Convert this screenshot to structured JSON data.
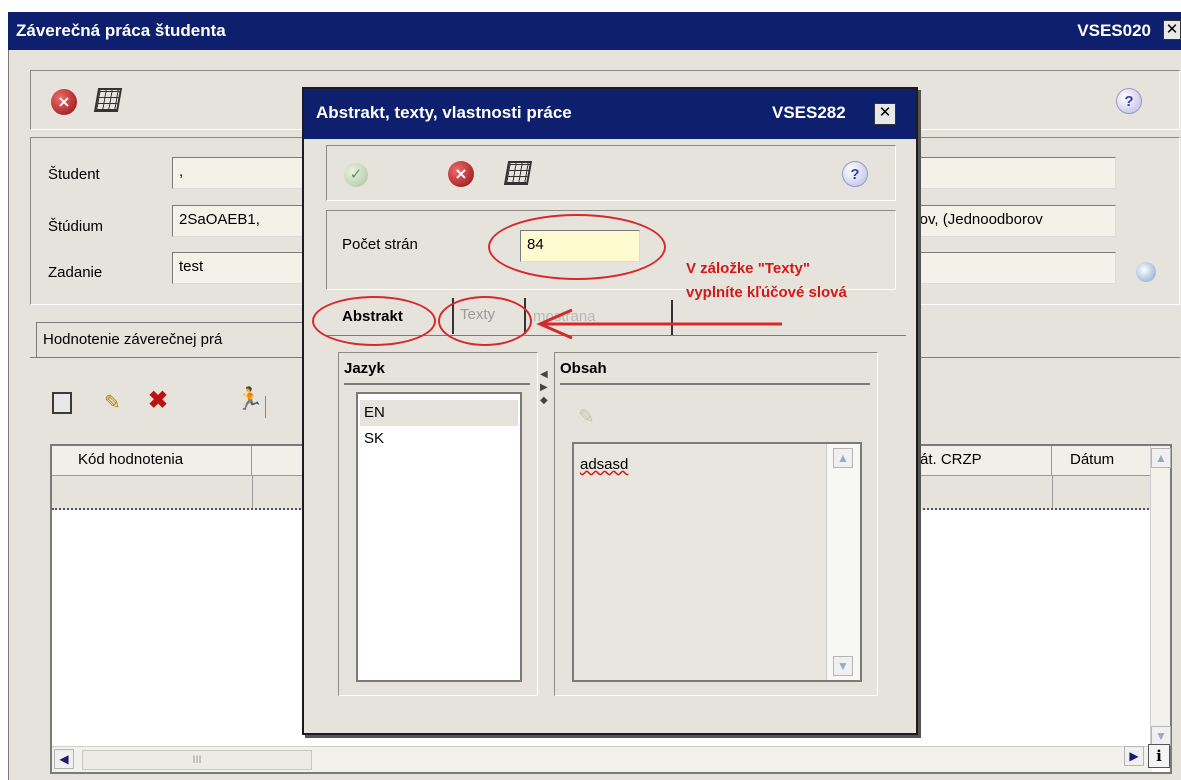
{
  "main": {
    "title": "Záverečná práca študenta",
    "code": "VSES020",
    "close": "✕",
    "toolbar": {
      "cancel_icon": "cancel-icon",
      "grid_icon": "grid-icon",
      "help_icon": "help-icon"
    },
    "fields": {
      "student_label": "Študent",
      "student_value": ",",
      "studium_label": "Štúdium",
      "studium_value": "2SaOAEB1,",
      "studium_value_right": "ilov, (Jednoodborov",
      "zadanie_label": "Zadanie",
      "zadanie_value": "test"
    },
    "tab_label": "Hodnotenie záverečnej prá",
    "table": {
      "col_kod": "Kód hodnotenia",
      "col_crzp": "át. CRZP",
      "col_datum": "Dátum"
    },
    "scroll_thumb": "III",
    "info": "i"
  },
  "dialog": {
    "title": "Abstrakt, texty, vlastnosti práce",
    "code": "VSES282",
    "close": "✕",
    "pocet_label": "Počet strán",
    "pocet_value": "84",
    "tabs": {
      "abstrakt": "Abstrakt",
      "texty": "Texty",
      "third": "mostrana"
    },
    "jazyk_header": "Jazyk",
    "obsah_header": "Obsah",
    "languages": [
      "EN",
      "SK"
    ],
    "obsah_text": "adsasd"
  },
  "annotation": {
    "line1": "V záložke \"Texty\"",
    "line2": "vyplníte kľúčové slová"
  },
  "colors": {
    "titlebar": "#0e1f6e",
    "annotation": "#d01a1a",
    "input_highlight": "#fffbd0"
  }
}
